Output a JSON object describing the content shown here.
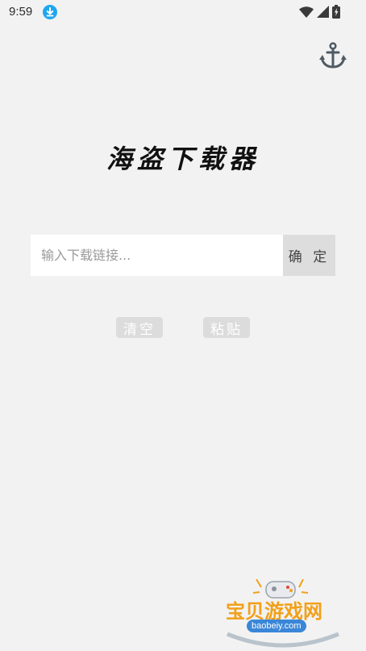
{
  "status_bar": {
    "time": "9:59",
    "icons": [
      "download-icon",
      "wifi-icon",
      "signal-icon",
      "battery-icon"
    ]
  },
  "header": {
    "anchor_icon": "anchor-icon"
  },
  "main": {
    "title": "海盗下载器",
    "url_input": {
      "value": "",
      "placeholder": "输入下载链接..."
    },
    "confirm_label": "确 定",
    "clear_label": "清空",
    "paste_label": "粘贴"
  },
  "watermark": {
    "text": "宝贝游戏网",
    "url": "baobeiy.com"
  },
  "colors": {
    "background": "#f2f2f2",
    "download_badge": "#1ea7f0",
    "watermark_orange": "#f2a019",
    "watermark_blue": "#3a86d8"
  }
}
